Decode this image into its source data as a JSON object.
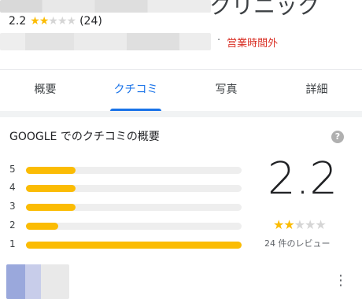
{
  "header": {
    "title": "クリニック",
    "rating_text": "2.2",
    "rating_count": "(24)",
    "stars": [
      true,
      true,
      false,
      false,
      false
    ],
    "status_separator": "·",
    "status": "営業時間外"
  },
  "tabs": [
    {
      "label": "概要",
      "active": false
    },
    {
      "label": "クチコミ",
      "active": true
    },
    {
      "label": "写真",
      "active": false
    },
    {
      "label": "詳細",
      "active": false
    }
  ],
  "reviews_summary": {
    "title": "GOOGLE でのクチコミの概要",
    "help_icon_glyph": "?",
    "distribution": [
      {
        "label": "5",
        "fraction": 0.23
      },
      {
        "label": "4",
        "fraction": 0.23
      },
      {
        "label": "3",
        "fraction": 0.23
      },
      {
        "label": "2",
        "fraction": 0.15
      },
      {
        "label": "1",
        "fraction": 1.0
      }
    ],
    "average": "2.2",
    "average_stars": [
      true,
      true,
      false,
      false,
      false
    ],
    "review_count_text": "24 件のレビュー"
  },
  "review_item": {
    "more_icon_glyph": "⋮"
  },
  "colors": {
    "accent": "#1a73e8",
    "star": "#fbbc04",
    "status": "#d93025"
  }
}
